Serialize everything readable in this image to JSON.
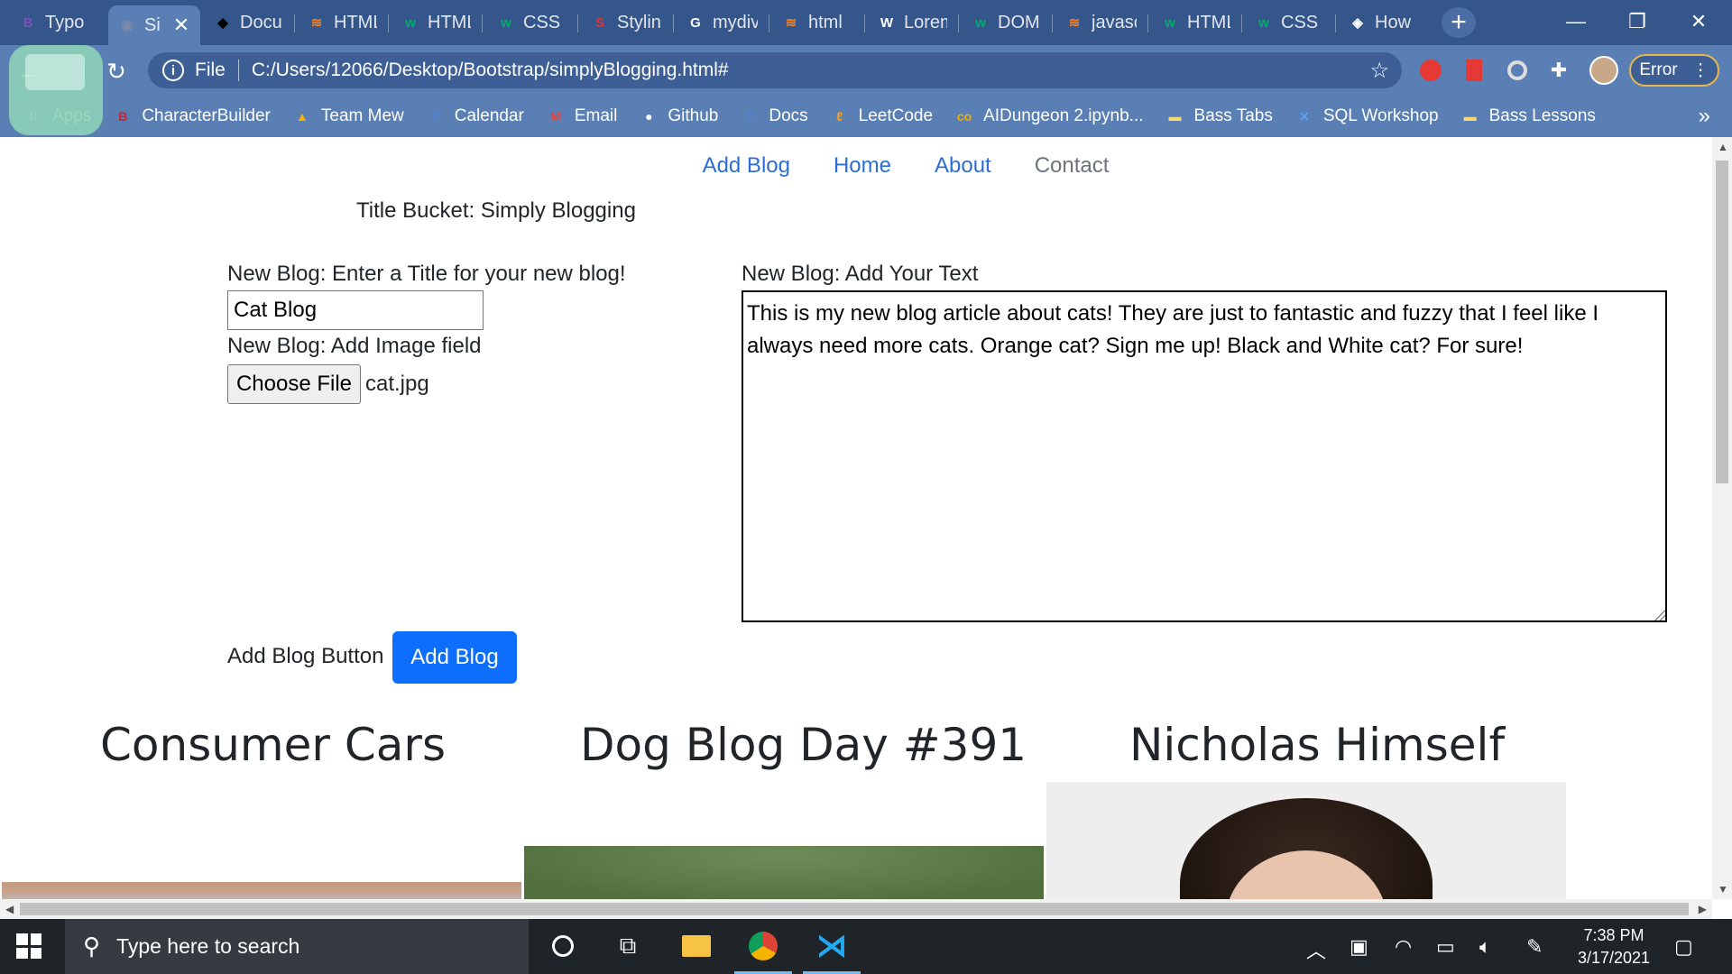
{
  "browser": {
    "tabs": [
      {
        "label": "Typo",
        "icon": "bootstrap-icon",
        "glyph": "B",
        "color": "#7952b3"
      },
      {
        "label": "Si",
        "icon": "page-icon",
        "glyph": "◉",
        "color": "#7a8aa6",
        "active": true
      },
      {
        "label": "Docu",
        "icon": "codepen-icon",
        "glyph": "◆",
        "color": "#000000"
      },
      {
        "label": "HTML",
        "icon": "stackoverflow-icon",
        "glyph": "≋",
        "color": "#f48024"
      },
      {
        "label": "HTML",
        "icon": "w3schools-icon",
        "glyph": "w",
        "color": "#04aa6d"
      },
      {
        "label": "CSS B",
        "icon": "w3schools-icon",
        "glyph": "w",
        "color": "#04aa6d"
      },
      {
        "label": "Stylin",
        "icon": "shecodes-icon",
        "glyph": "S",
        "color": "#e23237"
      },
      {
        "label": "mydiv",
        "icon": "google-icon",
        "glyph": "G",
        "color": "#ffffff"
      },
      {
        "label": "html",
        "icon": "stackoverflow-icon",
        "glyph": "≋",
        "color": "#f48024"
      },
      {
        "label": "Lorem",
        "icon": "wikipedia-icon",
        "glyph": "W",
        "color": "#ffffff"
      },
      {
        "label": "DOM",
        "icon": "w3schools-icon",
        "glyph": "w",
        "color": "#04aa6d"
      },
      {
        "label": "javasc",
        "icon": "stackoverflow-icon",
        "glyph": "≋",
        "color": "#f48024"
      },
      {
        "label": "HTML",
        "icon": "w3schools-icon",
        "glyph": "w",
        "color": "#04aa6d"
      },
      {
        "label": "CSS B",
        "icon": "w3schools-icon",
        "glyph": "w",
        "color": "#04aa6d"
      },
      {
        "label": "How",
        "icon": "codecademy-icon",
        "glyph": "◈",
        "color": "#ffffff"
      }
    ],
    "url_scheme": "File",
    "url": "C:/Users/12066/Desktop/Bootstrap/simplyBlogging.html#",
    "error_label": "Error",
    "bookmarks": [
      {
        "label": "Apps",
        "icon": "apps-icon",
        "glyph": "⁞⁞",
        "color": "#ffffff"
      },
      {
        "label": "CharacterBuilder",
        "icon": "characterbuilder-icon",
        "glyph": "B",
        "color": "#d61f26"
      },
      {
        "label": "Team Mew",
        "icon": "google-drive-icon",
        "glyph": "▲",
        "color": "#f4b400"
      },
      {
        "label": "Calendar",
        "icon": "calendar-icon",
        "glyph": "7",
        "color": "#4285f4"
      },
      {
        "label": "Email",
        "icon": "gmail-icon",
        "glyph": "M",
        "color": "#ea4335"
      },
      {
        "label": "Github",
        "icon": "github-icon",
        "glyph": "●",
        "color": "#ffffff"
      },
      {
        "label": "Docs",
        "icon": "google-docs-icon",
        "glyph": "≡",
        "color": "#4285f4"
      },
      {
        "label": "LeetCode",
        "icon": "leetcode-icon",
        "glyph": "ℓ",
        "color": "#f89f1b"
      },
      {
        "label": "AIDungeon 2.ipynb...",
        "icon": "colab-icon",
        "glyph": "co",
        "color": "#f9ab00"
      },
      {
        "label": "Bass Tabs",
        "icon": "folder-icon",
        "glyph": "▬",
        "color": "#f8d775"
      },
      {
        "label": "SQL Workshop",
        "icon": "sql-workshop-icon",
        "glyph": "✕",
        "color": "#5ea0ef"
      },
      {
        "label": "Bass Lessons",
        "icon": "folder-icon",
        "glyph": "▬",
        "color": "#f8d775"
      }
    ],
    "overflow_glyph": "»"
  },
  "page": {
    "nav": {
      "add_blog": "Add Blog",
      "home": "Home",
      "about": "About",
      "contact": "Contact"
    },
    "title_bucket": "Title Bucket: Simply Blogging",
    "form": {
      "title_label": "New Blog: Enter a Title for your new blog!",
      "title_value": "Cat Blog",
      "image_label": "New Blog: Add Image field",
      "choose_file": "Choose File",
      "file_name": "cat.jpg",
      "text_label": "New Blog: Add Your Text",
      "text_value": "This is my new blog article about cats! They are just to fantastic and fuzzy that I feel like I always need more cats. Orange cat? Sign me up! Black and White cat? For sure!",
      "button_label": "Add Blog Button",
      "button_text": "Add Blog"
    },
    "cards": [
      {
        "title": "Consumer Cars"
      },
      {
        "title": "Dog Blog Day #391"
      },
      {
        "title": "Nicholas Himself"
      }
    ]
  },
  "taskbar": {
    "search_placeholder": "Type here to search",
    "time": "7:38 PM",
    "date": "3/17/2021"
  }
}
